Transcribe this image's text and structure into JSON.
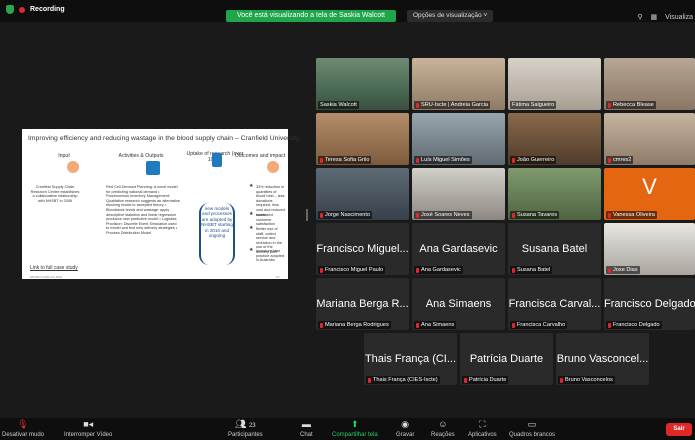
{
  "topbar": {
    "recording_label": "Recording",
    "share_banner": "Você está visualizando a tela de Saskia Walcott",
    "view_options": "Opções de visualização",
    "view_options_chevron": "˅",
    "right_label": "Visualiza"
  },
  "slide": {
    "title": "Improving efficiency and reducing wastage in the blood supply chain – Cranfield University",
    "col_input": "Input",
    "col_activities": "Activities & Outputs",
    "col_uptake": "Uptake of research (over 10yrs)",
    "col_outcomes": "Outcomes and impact",
    "input_text": "Cranfield Supply Chain Research Centre establishes a collaborative relationship with NHSBT in 2006",
    "activities_text": "Red Cell Demand Planning: a novel model for predicting national demand • Parsimonious Inventory Management: Qualitative research suggests an alternative stocking model to accepted theory • Bloodstock levels and wastage: apply descriptive statistics and linear regression produces new predictive model • Logistics Provision: Discrete Event Simulation used to model and test new delivery strategies • Process Distribution Model",
    "uptake_text": "new models and processes are adopted by NHSBT starting in 2010 and ongoing",
    "outcome_1": "33% reduction in quantities of blood held – less donations required, less cost and reduced waste",
    "outcome_2": "Increased customer satisfaction",
    "outcome_3": "Better use of staff, collect service and reduction in the use of the delivery fleet",
    "outcome_4": "Inventory best practice adopted in Australia",
    "link": "Link to full case study",
    "footer": "EPSRC/CASE Oct 2020",
    "page": "10"
  },
  "participants": [
    {
      "name": "Saskia Walcott",
      "type": "video",
      "muted": false
    },
    {
      "name": "SRU-Iscte | Andreia Garcia",
      "type": "video",
      "muted": true
    },
    {
      "name": "Fátima Salgueiro",
      "type": "video",
      "muted": false
    },
    {
      "name": "Rebecca Blease",
      "type": "video",
      "muted": true
    },
    {
      "name": "Teresa Sofia Grilo",
      "type": "video",
      "muted": true
    },
    {
      "name": "Luís Miguel Simões",
      "type": "video",
      "muted": true
    },
    {
      "name": "João Guerreiro",
      "type": "video",
      "muted": true
    },
    {
      "name": "cmres2",
      "type": "video",
      "muted": true
    },
    {
      "name": "Jorge Nascimento",
      "type": "video",
      "muted": true
    },
    {
      "name": "José Soares Neves",
      "type": "video",
      "muted": true
    },
    {
      "name": "Susana Tavares",
      "type": "video",
      "muted": true
    },
    {
      "name": "Vanessa Oliveira",
      "type": "avatar",
      "letter": "V",
      "muted": true
    },
    {
      "display": "Francisco Miguel...",
      "name": "Francisco Miguel Paulo",
      "type": "text",
      "muted": true
    },
    {
      "display": "Ana Gardasevic",
      "name": "Ana Gardasevic",
      "type": "text",
      "muted": true
    },
    {
      "display": "Susana Batel",
      "name": "Susana Batel",
      "type": "text",
      "muted": true
    },
    {
      "name": "Jose Dias",
      "type": "video",
      "muted": true
    },
    {
      "display": "Mariana Berga R...",
      "name": "Mariana Berga Rodrigues",
      "type": "text",
      "muted": true
    },
    {
      "display": "Ana Simaens",
      "name": "Ana Simaens",
      "type": "text",
      "muted": true
    },
    {
      "display": "Francisca Carval...",
      "name": "Francisca Carvalho",
      "type": "text",
      "muted": true
    },
    {
      "display": "Francisco Delgado",
      "name": "Francisco Delgado",
      "type": "text",
      "muted": true
    },
    {
      "display": "Thais França (CI...",
      "name": "Thais França (CIES-Iscte)",
      "type": "text",
      "muted": true
    },
    {
      "display": "Patrícia Duarte",
      "name": "Patrícia Duarte",
      "type": "text",
      "muted": true
    },
    {
      "display": "Bruno Vasconcel...",
      "name": "Bruno Vasconcelos",
      "type": "text",
      "muted": true
    }
  ],
  "toolbar": {
    "unmute": "Desativar mudo",
    "stop_video": "Interromper Vídeo",
    "participants": "Participantes",
    "participants_count": "23",
    "chat": "Chat",
    "share_screen": "Compartilhar tela",
    "record": "Gravar",
    "reactions": "Reações",
    "apps": "Aplicativos",
    "whiteboards": "Quadros brancos",
    "leave": "Sair"
  },
  "colors": {
    "active_speaker": "#23d160",
    "mute_red": "#e02828",
    "share_green": "#1fa64a",
    "avatar_orange": "#e46611"
  }
}
